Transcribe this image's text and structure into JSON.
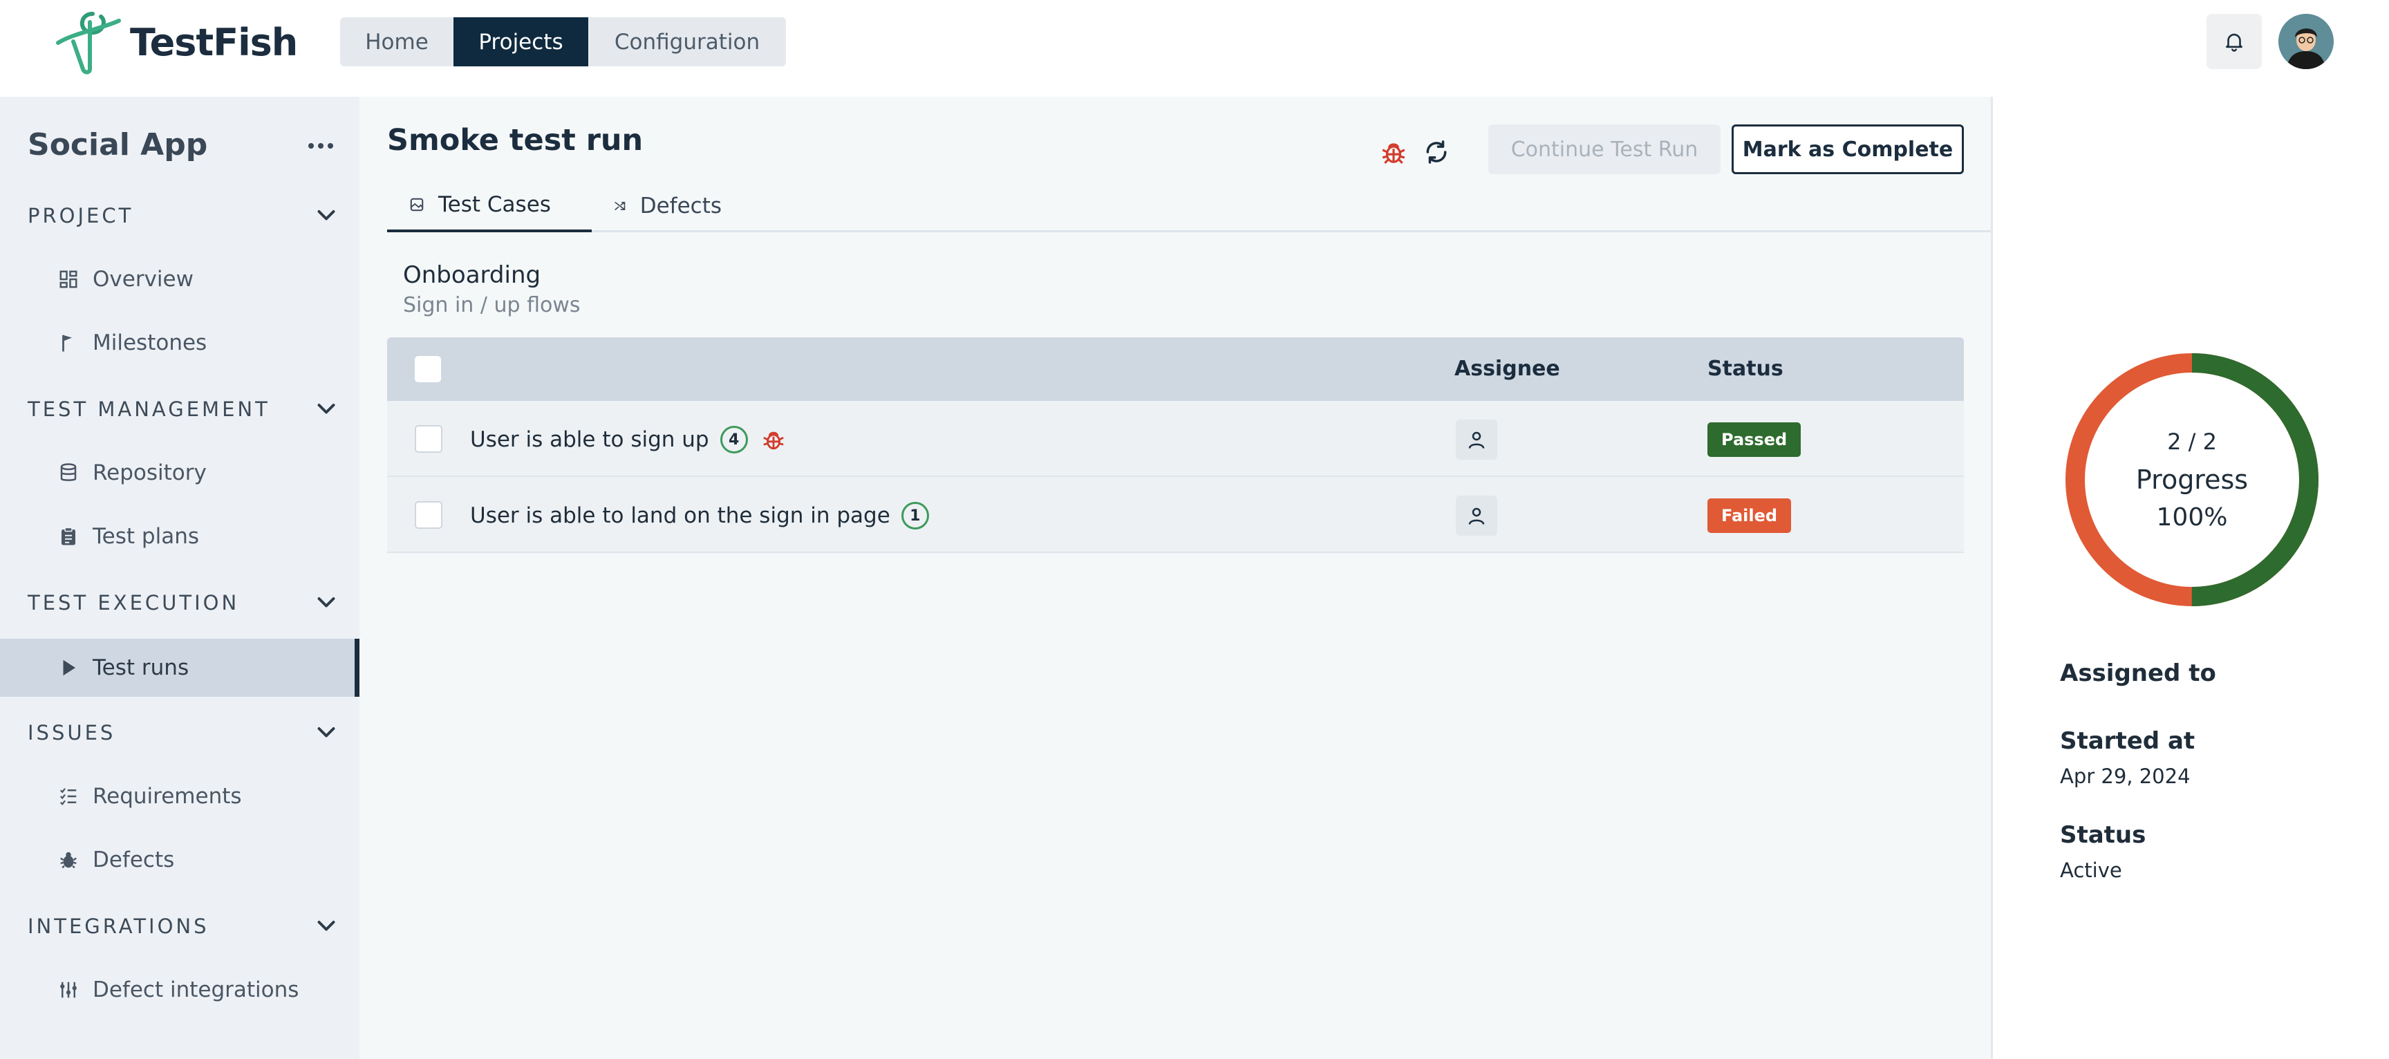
{
  "app": {
    "logo_text": "TestFish"
  },
  "topnav": {
    "items": [
      "Home",
      "Projects",
      "Configuration"
    ],
    "active": "Projects"
  },
  "sidebar": {
    "project_name": "Social App",
    "sections": [
      {
        "title": "PROJECT",
        "items": [
          "Overview",
          "Milestones"
        ]
      },
      {
        "title": "TEST MANAGEMENT",
        "items": [
          "Repository",
          "Test plans"
        ]
      },
      {
        "title": "TEST EXECUTION",
        "items": [
          "Test runs"
        ]
      },
      {
        "title": "ISSUES",
        "items": [
          "Requirements",
          "Defects"
        ]
      },
      {
        "title": "INTEGRATIONS",
        "items": [
          "Defect integrations"
        ]
      }
    ],
    "active_item": "Test runs"
  },
  "main": {
    "title": "Smoke test run",
    "actions": {
      "continue_label": "Continue Test Run",
      "complete_label": "Mark as Complete"
    },
    "tabs": [
      "Test Cases",
      "Defects"
    ],
    "active_tab": "Test Cases",
    "suite": {
      "title": "Onboarding",
      "subtitle": "Sign in / up flows"
    },
    "table": {
      "columns": {
        "assignee": "Assignee",
        "status": "Status"
      },
      "rows": [
        {
          "name": "User is able to sign up",
          "count": "4",
          "has_defect": true,
          "status": "Passed",
          "status_color": "#2e6b2e"
        },
        {
          "name": "User is able to land on the sign in page",
          "count": "1",
          "has_defect": false,
          "status": "Failed",
          "status_color": "#e05a35"
        }
      ]
    }
  },
  "right_panel": {
    "progress": {
      "fraction": "2 / 2",
      "label": "Progress",
      "percent": "100%",
      "passed_share": 0.5,
      "failed_share": 0.5,
      "passed_color": "#2e6b2e",
      "failed_color": "#e05a35"
    },
    "assigned_label": "Assigned to",
    "started_label": "Started at",
    "started_value": "Apr 29, 2024",
    "status_label": "Status",
    "status_value": "Active"
  }
}
